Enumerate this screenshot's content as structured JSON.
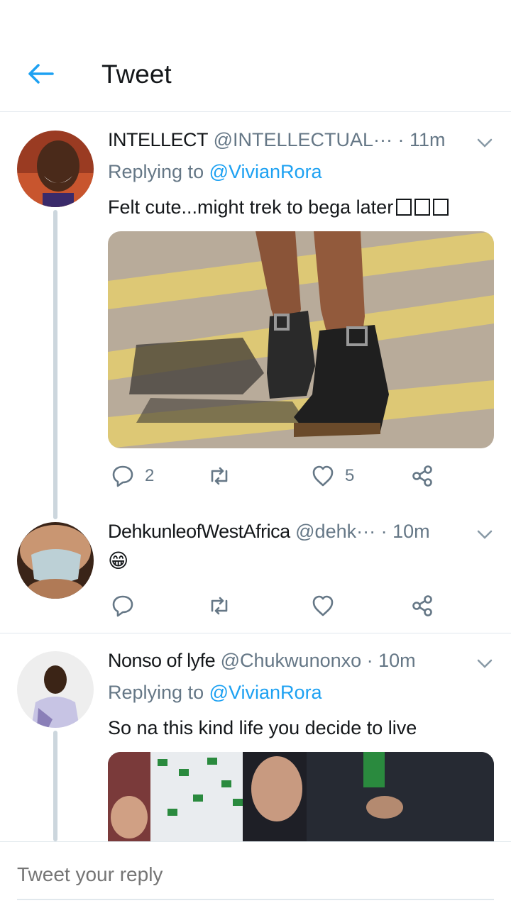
{
  "header": {
    "title": "Tweet"
  },
  "tweets": [
    {
      "name": "INTELLECT",
      "handle": "@INTELLECTUAL···",
      "time": "· 11m",
      "replying_prefix": "Replying to ",
      "replying_handle": "@VivianRora",
      "text": "Felt cute...might trek to bega later",
      "actions": {
        "reply_count": "2",
        "retweet_count": "",
        "like_count": "5"
      }
    },
    {
      "name": "DehkunleofWestAfrica",
      "handle": "@dehk···",
      "time": "· 10m",
      "text": "😁",
      "actions": {
        "reply_count": "",
        "retweet_count": "",
        "like_count": ""
      }
    },
    {
      "name": "Nonso of lyfe",
      "handle": "@Chukwunonxo",
      "time": "· 10m",
      "replying_prefix": "Replying to ",
      "replying_handle": "@VivianRora",
      "text": "So na this kind life you decide to live"
    }
  ],
  "composer": {
    "placeholder": "Tweet your reply"
  },
  "colors": {
    "accent": "#1da1f2",
    "secondary_text": "#657786",
    "divider": "#e1e8ed",
    "thread_line": "#ccd6dd"
  }
}
